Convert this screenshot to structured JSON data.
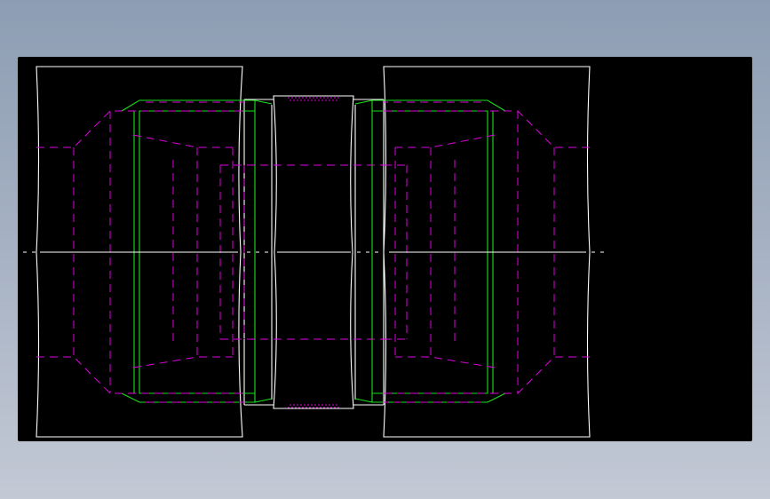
{
  "scene": {
    "kind": "cad-drawing-viewport",
    "background_color": "#000000",
    "colors": {
      "visible_edge": "#ffffff",
      "tangent_edge": "#19e01c",
      "hidden_edge": "#e000e0",
      "page_gradient_top": "#8d9db3",
      "page_gradient_bottom": "#c3c9d5"
    }
  }
}
